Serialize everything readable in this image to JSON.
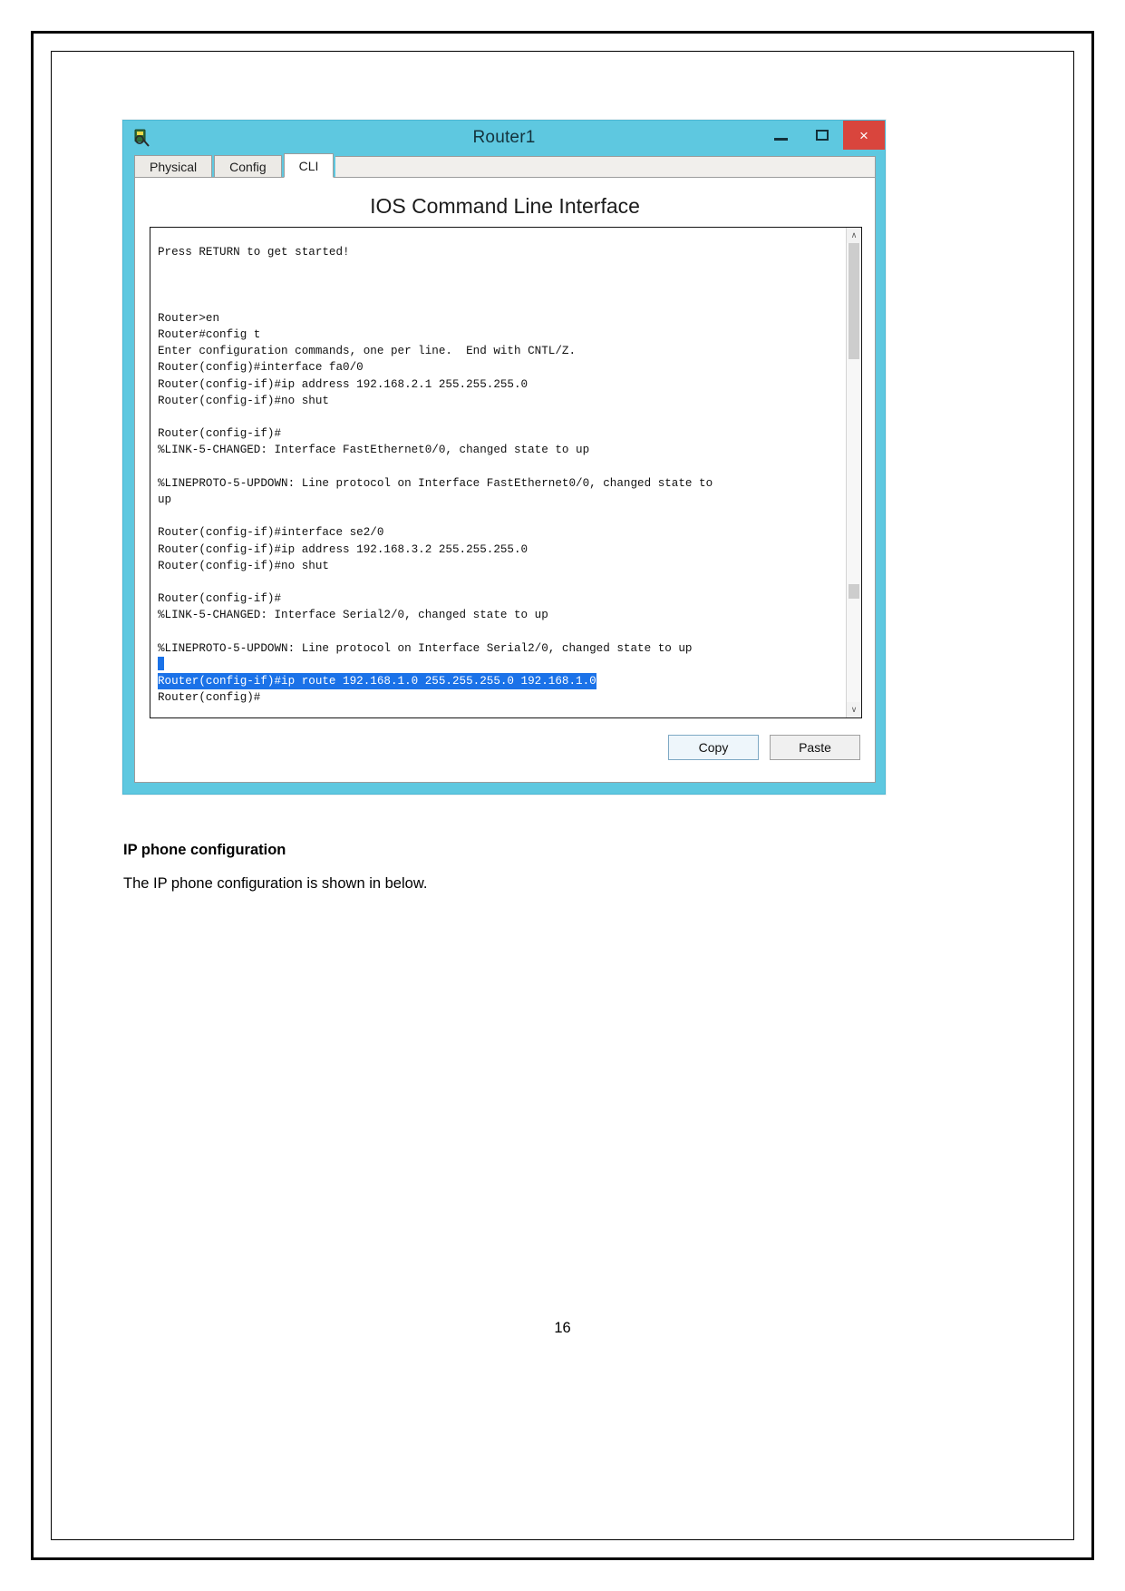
{
  "document": {
    "heading": "IP phone configuration",
    "paragraph": "The IP phone configuration is shown in below.",
    "page_number": "16"
  },
  "window": {
    "title": "Router1",
    "icon": "router-device-icon",
    "controls": {
      "minimize": "–",
      "maximize": "☐",
      "close": "×"
    },
    "accent_color": "#5ec8e0",
    "close_color": "#d9453d"
  },
  "tabs": [
    {
      "label": "Physical",
      "active": false
    },
    {
      "label": "Config",
      "active": false
    },
    {
      "label": "CLI",
      "active": true
    }
  ],
  "cli": {
    "heading": "IOS Command Line Interface",
    "selection_color": "#1b72e8",
    "lines": [
      {
        "text": "Press RETURN to get started!",
        "selected": false
      },
      {
        "text": "",
        "selected": false
      },
      {
        "text": "",
        "selected": false
      },
      {
        "text": "",
        "selected": false
      },
      {
        "text": "Router>en",
        "selected": false
      },
      {
        "text": "Router#config t",
        "selected": false
      },
      {
        "text": "Enter configuration commands, one per line.  End with CNTL/Z.",
        "selected": false
      },
      {
        "text": "Router(config)#interface fa0/0",
        "selected": false
      },
      {
        "text": "Router(config-if)#ip address 192.168.2.1 255.255.255.0",
        "selected": false
      },
      {
        "text": "Router(config-if)#no shut",
        "selected": false
      },
      {
        "text": "",
        "selected": false
      },
      {
        "text": "Router(config-if)#",
        "selected": false
      },
      {
        "text": "%LINK-5-CHANGED: Interface FastEthernet0/0, changed state to up",
        "selected": false
      },
      {
        "text": "",
        "selected": false
      },
      {
        "text": "%LINEPROTO-5-UPDOWN: Line protocol on Interface FastEthernet0/0, changed state to",
        "selected": false
      },
      {
        "text": "up",
        "selected": false
      },
      {
        "text": "",
        "selected": false
      },
      {
        "text": "Router(config-if)#interface se2/0",
        "selected": false
      },
      {
        "text": "Router(config-if)#ip address 192.168.3.2 255.255.255.0",
        "selected": false
      },
      {
        "text": "Router(config-if)#no shut",
        "selected": false
      },
      {
        "text": "",
        "selected": false
      },
      {
        "text": "Router(config-if)#",
        "selected": false
      },
      {
        "text": "%LINK-5-CHANGED: Interface Serial2/0, changed state to up",
        "selected": false
      },
      {
        "text": "",
        "selected": false
      },
      {
        "text": "%LINEPROTO-5-UPDOWN: Line protocol on Interface Serial2/0, changed state to up",
        "selected": false
      },
      {
        "text": "__CURSOR__",
        "selected": false
      },
      {
        "text": "Router(config-if)#ip route 192.168.1.0 255.255.255.0 192.168.1.0",
        "selected": true
      },
      {
        "text": "Router(config)#",
        "selected": false
      }
    ],
    "scrollbar": {
      "up_arrow": "∧",
      "down_arrow": "∨"
    },
    "buttons": {
      "copy": "Copy",
      "paste": "Paste"
    }
  }
}
